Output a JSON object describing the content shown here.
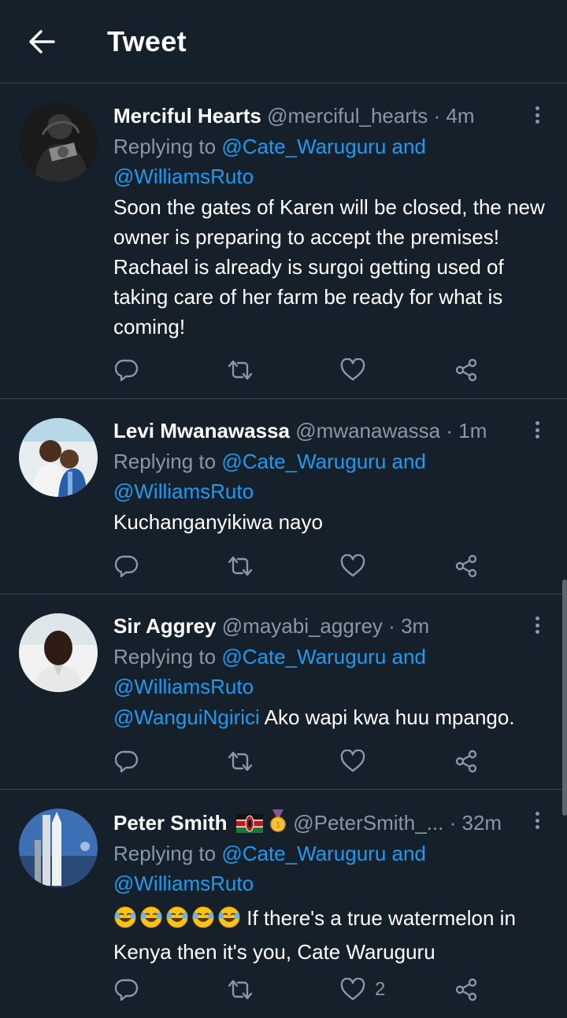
{
  "header": {
    "title": "Tweet"
  },
  "tweets": [
    {
      "name": "Merciful Hearts",
      "handle": "@merciful_hearts",
      "sep": "·",
      "time": "4m",
      "replying_prefix": "Replying to ",
      "replying_user1": "@Cate_Waruguru",
      "replying_and": " and",
      "replying_user2": "@WilliamsRuto",
      "text": "Soon the gates of Karen will be closed, the new owner is preparing to accept the premises! Rachael is already is surgoi getting used of taking care of her farm be ready for what is coming!",
      "like_count": ""
    },
    {
      "name": "Levi Mwanawassa",
      "handle": "@mwanawassa",
      "sep": "·",
      "time": "1m",
      "replying_prefix": "Replying to ",
      "replying_user1": "@Cate_Waruguru",
      "replying_and": " and",
      "replying_user2": "@WilliamsRuto",
      "text": "Kuchanganyikiwa nayo",
      "like_count": ""
    },
    {
      "name": "Sir Aggrey",
      "handle": "@mayabi_aggrey",
      "sep": "·",
      "time": "3m",
      "replying_prefix": "Replying to ",
      "replying_user1": "@Cate_Waruguru",
      "replying_and": " and",
      "replying_user2": "@WilliamsRuto",
      "text_mention": "@WanguiNgirici",
      "text": " Ako wapi kwa huu mpango.",
      "like_count": ""
    },
    {
      "name": "Peter Smith",
      "name_emoji": "🇰🇪🥇",
      "handle": "@PeterSmith_...",
      "sep": "·",
      "time": "32m",
      "replying_prefix": "Replying to ",
      "replying_user1": "@Cate_Waruguru",
      "replying_and": " and",
      "replying_user2": "@WilliamsRuto",
      "text_emoji": "🤣🤣🤣🤣🤣",
      "text": " If there's a true watermelon in Kenya then it's you, Cate Waruguru",
      "like_count": "2"
    }
  ],
  "icons": {
    "back": "arrow-left-icon",
    "more": "more-vertical-icon",
    "reply": "comment-icon",
    "retweet": "retweet-icon",
    "like": "heart-icon",
    "share": "share-icon"
  },
  "colors": {
    "background": "#15202b",
    "divider": "#38444d",
    "muted": "#8899a6",
    "link": "#1d9bf0"
  }
}
